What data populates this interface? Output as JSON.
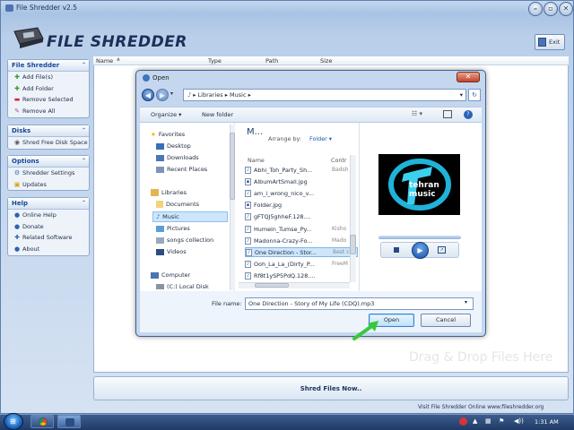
{
  "window": {
    "title": "File Shredder v2.5",
    "app_name": "FILE SHREDDER",
    "exit_label": "Exit"
  },
  "sidebar": {
    "panels": [
      {
        "header": "File Shredder",
        "items": [
          "Add File(s)",
          "Add Folder",
          "Remove Selected",
          "Remove All"
        ]
      },
      {
        "header": "Disks",
        "items": [
          "Shred Free Disk Space"
        ]
      },
      {
        "header": "Options",
        "items": [
          "Shredder Settings",
          "Updates"
        ]
      },
      {
        "header": "Help",
        "items": [
          "Online Help",
          "Donate",
          "Related Software",
          "About"
        ]
      }
    ]
  },
  "list": {
    "columns": [
      "Name",
      "Type",
      "Path",
      "Size"
    ],
    "watermark": "Drag & Drop Files Here"
  },
  "shred_button": "Shred Files Now..",
  "footer": {
    "link_text": "Visit File Shredder Online  www.fileshredder.org"
  },
  "dialog": {
    "title": "Open",
    "breadcrumb": [
      "Libraries",
      "Music"
    ],
    "toolbar": {
      "organize": "Organize ▾",
      "new_folder": "New folder"
    },
    "nav": [
      {
        "label": "Favorites",
        "icon": "star-icon"
      },
      {
        "label": "Desktop",
        "icon": "desktop-icon"
      },
      {
        "label": "Downloads",
        "icon": "downloads-icon"
      },
      {
        "label": "Recent Places",
        "icon": "recent-places-icon"
      },
      {
        "label": "Libraries",
        "icon": "libraries-icon"
      },
      {
        "label": "Documents",
        "icon": "documents-icon"
      },
      {
        "label": "Music",
        "icon": "music-icon"
      },
      {
        "label": "Pictures",
        "icon": "pictures-icon"
      },
      {
        "label": "songs collection",
        "icon": "folder-icon"
      },
      {
        "label": "Videos",
        "icon": "videos-icon"
      },
      {
        "label": "Computer",
        "icon": "computer-icon"
      },
      {
        "label": "(C:) Local Disk",
        "icon": "disk-icon"
      }
    ],
    "files_header": {
      "title": "M...",
      "arrange_label": "Arrange by:",
      "arrange_value": "Folder ▾",
      "col_name": "Name",
      "col_contrib": "Contr"
    },
    "files": [
      {
        "name": "Abhi_Toh_Party_Sh...",
        "contrib": "Badsh"
      },
      {
        "name": "AlbumArtSmall.jpg",
        "contrib": ""
      },
      {
        "name": "am_i_wrong_nico_v...",
        "contrib": ""
      },
      {
        "name": "Folder.jpg",
        "contrib": ""
      },
      {
        "name": "gFTQJ5ghheF.128....",
        "contrib": ""
      },
      {
        "name": "Humein_Tumse_Py...",
        "contrib": "Kisho"
      },
      {
        "name": "Madonna-Crazy-Fo...",
        "contrib": "Mado"
      },
      {
        "name": "One Direction - Stor...",
        "contrib": "Best c"
      },
      {
        "name": "Ooh_La_La_(Dirty_P...",
        "contrib": "FreeM"
      },
      {
        "name": "Rf8t1ySP5PdQ.128....",
        "contrib": ""
      }
    ],
    "preview_caption": "tehran music",
    "file_name_label": "File name:",
    "file_name_value": "One Direction - Story of My Life (CDQ).mp3",
    "open_label": "Open",
    "cancel_label": "Cancel"
  },
  "taskbar": {
    "time": "1:31 AM"
  },
  "colors": {
    "accent": "#17489a",
    "selected_row": "#cde6fb",
    "close_red": "#c2432b",
    "arrow_green": "#37c93a"
  }
}
